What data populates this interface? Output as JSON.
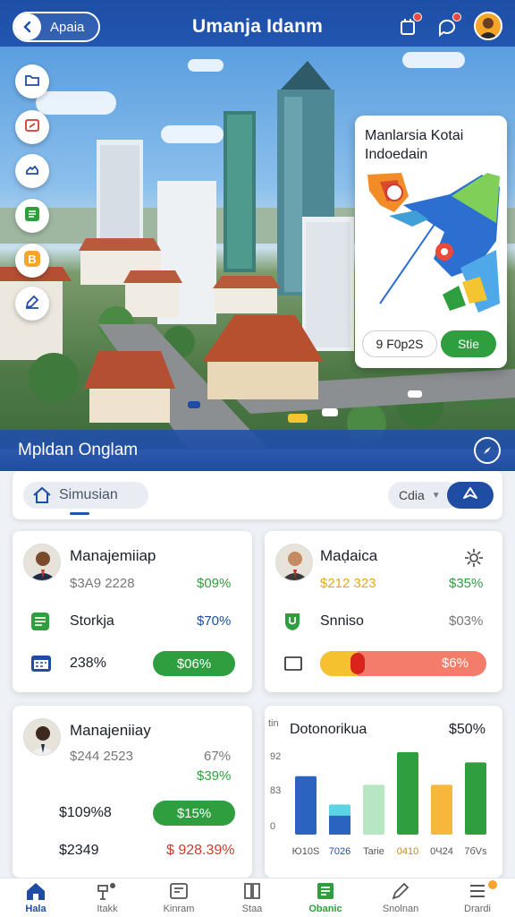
{
  "header": {
    "back_label": "Apaia",
    "title": "Umanja Idanm"
  },
  "map_card": {
    "title": "Manlarsia Kotai Indoedain",
    "chip_label": "9 F0p2S",
    "button_label": "Stie"
  },
  "section": {
    "title": "Mpldan Onglam"
  },
  "search": {
    "label": "Simusian",
    "select_value": "Cdia"
  },
  "cards": {
    "card1": {
      "name": "Manajemiiap",
      "amount": "$3A9 2228",
      "amount_pct": "$09%",
      "row1_label": "Storkja",
      "row1_pct": "$70%",
      "row2_label": "238%",
      "row2_pill": "$06%"
    },
    "card2": {
      "name": "Maḍaica",
      "amount": "$212 323",
      "amount_pct": "$35%",
      "row1_label": "Snniso",
      "row1_pct": "$03%",
      "bar_label": "$6%",
      "bar_progress": 0.17
    },
    "card3": {
      "name": "Manajeniiay",
      "amount": "$244 2523",
      "pct_top": "67%",
      "pct_green": "$39%",
      "row1_label": "$109%8",
      "row1_pill": "$15%",
      "row2_label": "$2349",
      "row2_value": "$ 928.39%"
    },
    "card4": {
      "chart_title": "Dotonorikua",
      "chart_pct": "$50%"
    }
  },
  "chart_data": {
    "type": "bar",
    "title": "Dotonorikua",
    "ylabel": "tin",
    "y_ticks": [
      "92",
      "83",
      "0"
    ],
    "categories": [
      "Ю10S",
      "7026",
      "Tarie",
      "0410",
      "0Ч24",
      "7бVs"
    ],
    "values": [
      68,
      35,
      58,
      96,
      58,
      84
    ],
    "stacked_bottom": [
      0,
      22,
      0,
      0,
      0,
      0
    ],
    "colors": [
      "#2a64c0",
      "#5bd5e4",
      "#b7e6c2",
      "#2e9e3e",
      "#f6b73c",
      "#2e9e3e"
    ],
    "bottom_color": "#2a64c0",
    "ylim": [
      0,
      100
    ]
  },
  "bottom_nav": [
    {
      "label": "Hala",
      "icon": "home-icon",
      "active": true
    },
    {
      "label": "Itakk",
      "icon": "structure-icon"
    },
    {
      "label": "Kinram",
      "icon": "register-icon"
    },
    {
      "label": "Staa",
      "icon": "book-icon"
    },
    {
      "label": "Obanic",
      "icon": "document-icon",
      "accent": true
    },
    {
      "label": "Snolnan",
      "icon": "pen-icon"
    },
    {
      "label": "Drardi",
      "icon": "menu-icon"
    }
  ],
  "colors": {
    "primary": "#1f4da3",
    "green": "#2e9e3e",
    "red": "#d23a2e",
    "amber": "#e7a81a"
  }
}
